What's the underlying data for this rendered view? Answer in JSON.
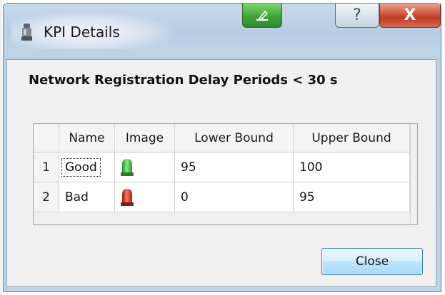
{
  "window": {
    "title": "KPI Details",
    "titlebar_buttons": {
      "edit_icon": "pencil-edit-icon",
      "help_label": "?",
      "close_label": "X"
    }
  },
  "dialog": {
    "heading": "Network Registration Delay Periods < 30 s"
  },
  "table": {
    "columns": [
      "Name",
      "Image",
      "Lower Bound",
      "Upper Bound"
    ],
    "rows": [
      {
        "index": "1",
        "name": "Good",
        "image": "green-light-icon",
        "lower": "95",
        "upper": "100"
      },
      {
        "index": "2",
        "name": "Bad",
        "image": "red-light-icon",
        "lower": "0",
        "upper": "95"
      }
    ]
  },
  "buttons": {
    "close_label": "Close"
  },
  "colors": {
    "good_light": "#3cbf3a",
    "bad_light": "#d8261a",
    "close_titlebar": "#c33b22"
  }
}
